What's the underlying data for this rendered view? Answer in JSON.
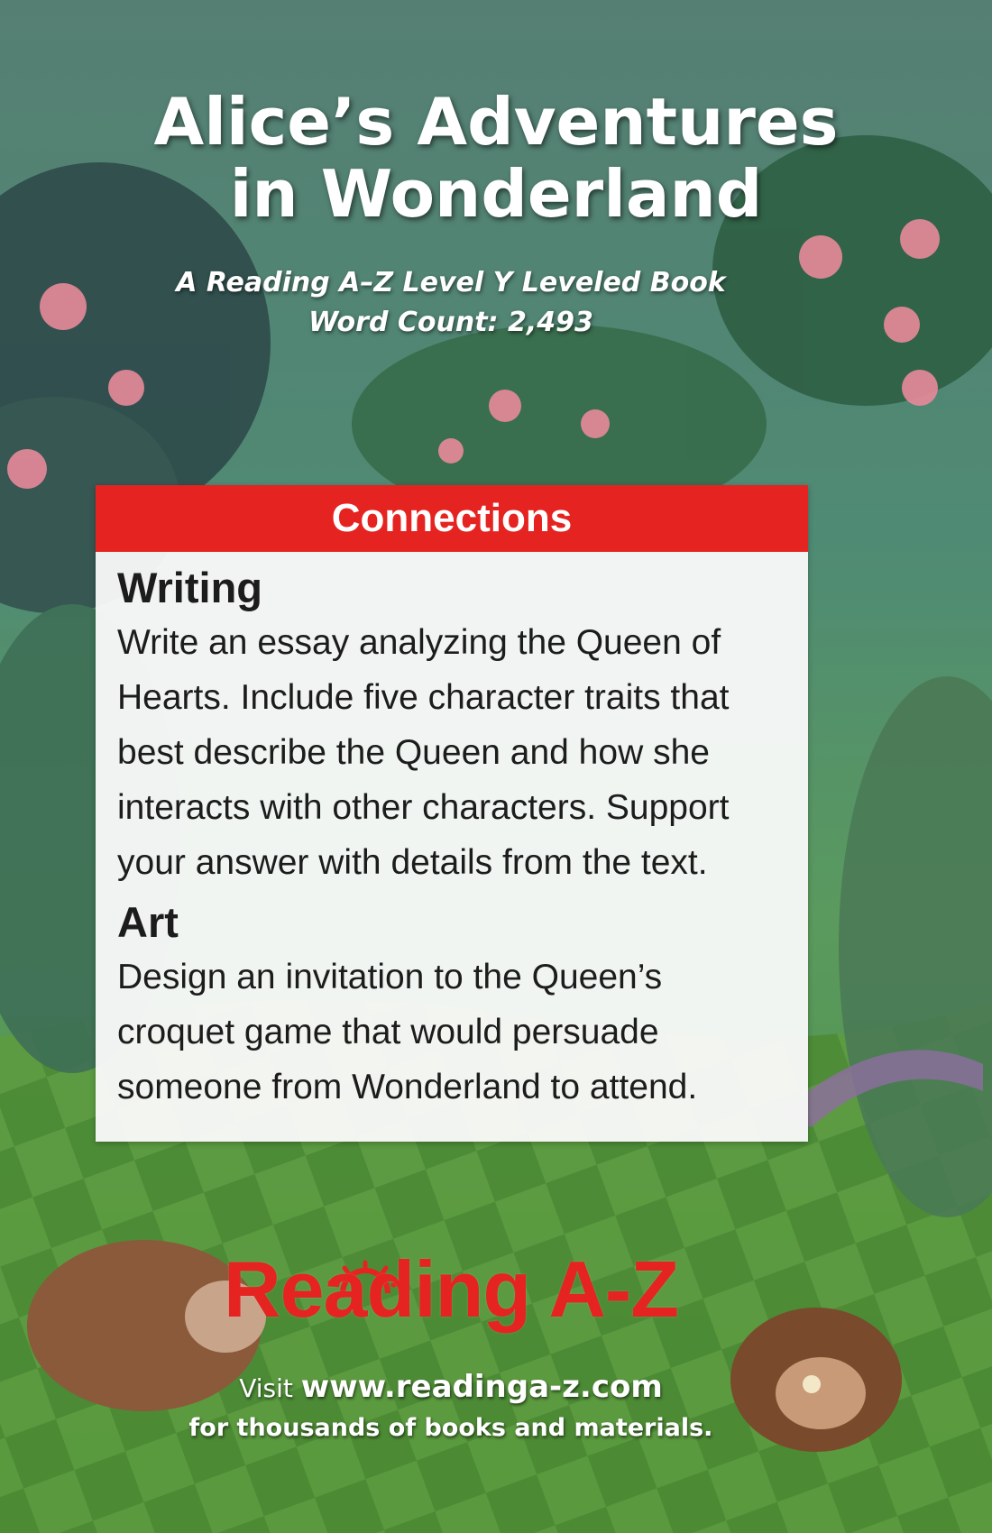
{
  "cover": {
    "title_line1": "Alice’s Adventures",
    "title_line2": "in Wonderland",
    "subtitle_line1": "A Reading A–Z Level Y Leveled Book",
    "subtitle_line2": "Word Count: 2,493"
  },
  "connections": {
    "header": "Connections",
    "sections": [
      {
        "heading": "Writing",
        "text": "Write an essay analyzing the Queen of Hearts. Include five character traits that best describe the Queen and how she interacts with other characters. Support your answer with details from the text."
      },
      {
        "heading": "Art",
        "text": "Design an invitation to the Queen’s croquet game that would persuade someone from Wonderland to attend."
      }
    ]
  },
  "footer": {
    "brand": "Reading A-Z",
    "visit_label": "Visit",
    "url": "www.readinga-z.com",
    "tagline": "for thousands of books and materials."
  },
  "colors": {
    "accent_red": "#e52421",
    "card_bg": "#fafafa"
  },
  "icons": {
    "brand_sun": "sun-rays-icon"
  }
}
